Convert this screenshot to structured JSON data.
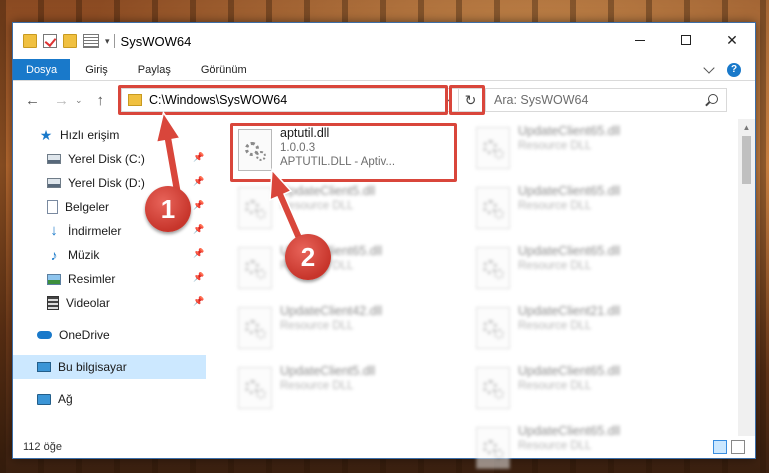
{
  "window": {
    "title": "SysWOW64",
    "controls": {
      "minimize": "—",
      "maximize": "☐",
      "close": "✕"
    }
  },
  "ribbon": {
    "tabs": [
      {
        "label": "Dosya",
        "active": true
      },
      {
        "label": "Giriş"
      },
      {
        "label": "Paylaş"
      },
      {
        "label": "Görünüm"
      }
    ],
    "help": "?"
  },
  "address_bar": {
    "path": "C:\\Windows\\SysWOW64",
    "refresh_icon": "↻",
    "dropdown_icon": "⌄"
  },
  "search": {
    "placeholder": "Ara: SysWOW64"
  },
  "navigation_pane": {
    "quick_access": "Hızlı erişim",
    "items": [
      {
        "label": "Yerel Disk (C:)",
        "icon": "drive-icon",
        "pinned": true
      },
      {
        "label": "Yerel Disk (D:)",
        "icon": "drive-icon",
        "pinned": true
      },
      {
        "label": "Belgeler",
        "icon": "document-icon",
        "pinned": true
      },
      {
        "label": "İndirmeler",
        "icon": "download-icon",
        "pinned": true
      },
      {
        "label": "Müzik",
        "icon": "music-icon",
        "pinned": true
      },
      {
        "label": "Resimler",
        "icon": "pictures-icon",
        "pinned": true
      },
      {
        "label": "Videolar",
        "icon": "videos-icon",
        "pinned": true
      }
    ],
    "onedrive": "OneDrive",
    "this_pc": "Bu bilgisayar",
    "network": "Ağ"
  },
  "files": {
    "highlighted": {
      "name": "aptutil.dll",
      "version": "1.0.0.3",
      "description": "APTUTIL.DLL - Aptiv..."
    },
    "col1": [
      {
        "name": "UpdateClient5.dll",
        "description": "Resource DLL"
      },
      {
        "name": "UpdateClient65.dll",
        "description": "Resource DLL"
      },
      {
        "name": "UpdateClient42.dll",
        "description": "Resource DLL"
      },
      {
        "name": "UpdateClient5.dll",
        "description": "Resource DLL"
      }
    ],
    "col2": [
      {
        "name": "UpdateClient65.dll",
        "description": "Resource DLL"
      },
      {
        "name": "UpdateClient65.dll",
        "description": "Resource DLL"
      },
      {
        "name": "UpdateClient65.dll",
        "description": "Resource DLL"
      },
      {
        "name": "UpdateClient21.dll",
        "description": "Resource DLL"
      },
      {
        "name": "UpdateClient65.dll",
        "description": "Resource DLL"
      },
      {
        "name": "UpdateClient65.dll",
        "description": "Resource DLL"
      }
    ]
  },
  "status": {
    "item_count": "112 öğe"
  },
  "annotations": {
    "step1": "1",
    "step2": "2",
    "color": "#d9463b"
  }
}
